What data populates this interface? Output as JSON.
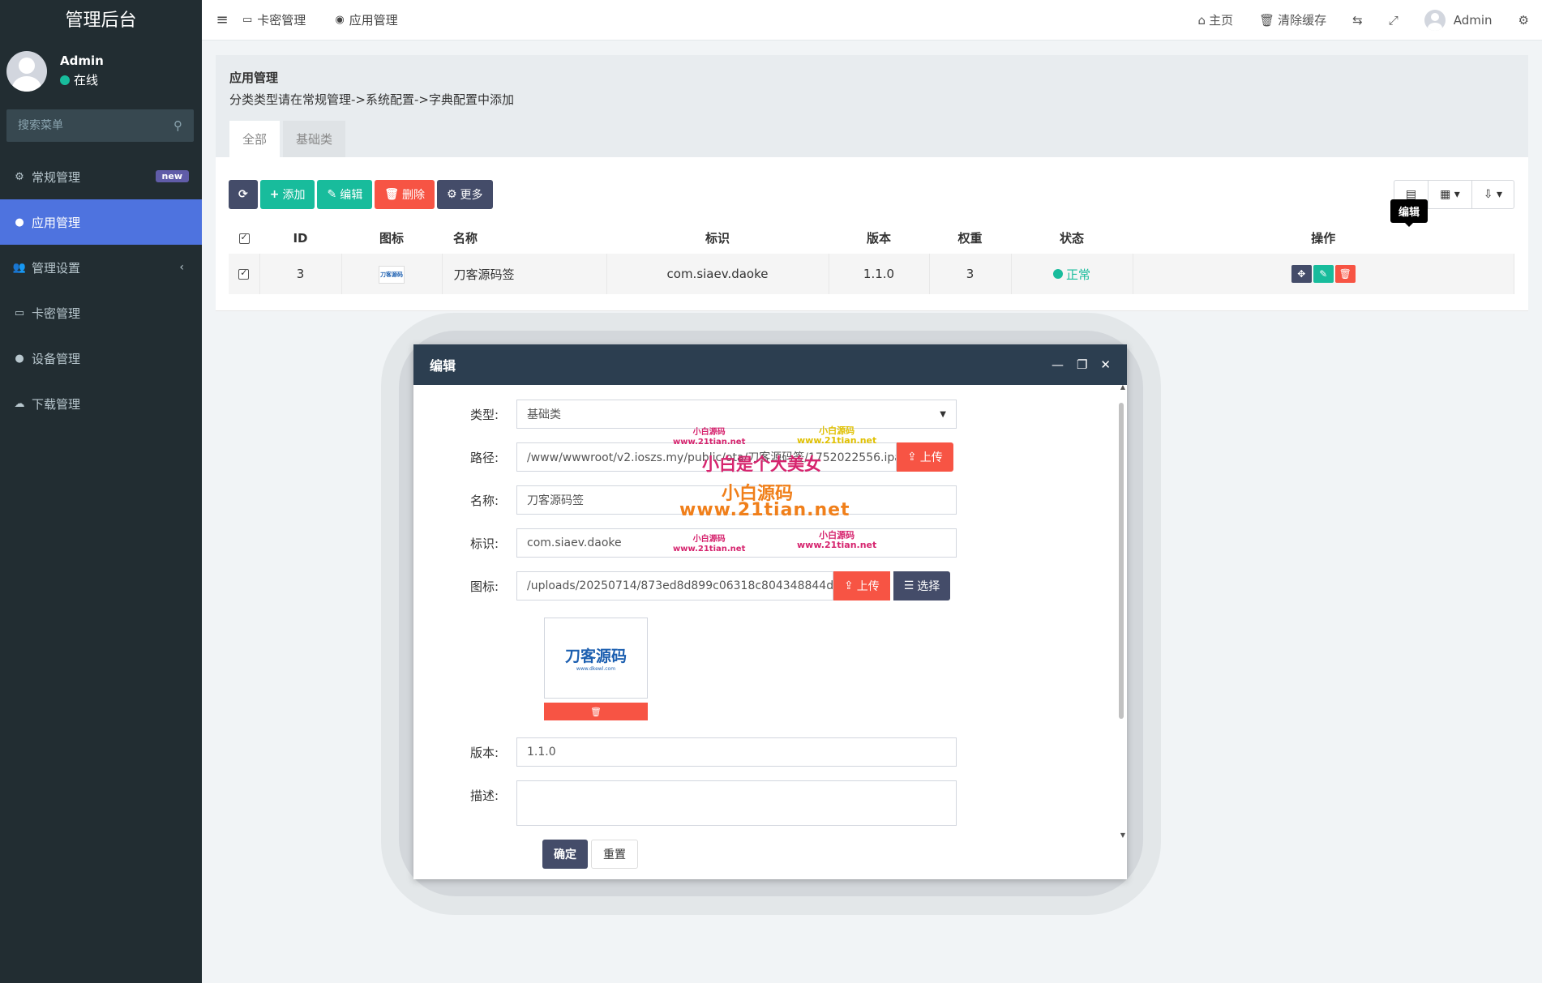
{
  "sidebar": {
    "logo": "管理后台",
    "user_name": "Admin",
    "user_status": "在线",
    "search_placeholder": "搜索菜单",
    "items": [
      {
        "label": "常规管理",
        "badge": "new"
      },
      {
        "label": "应用管理"
      },
      {
        "label": "管理设置"
      },
      {
        "label": "卡密管理"
      },
      {
        "label": "设备管理"
      },
      {
        "label": "下载管理"
      }
    ]
  },
  "topbar": {
    "tabs": [
      "卡密管理",
      "应用管理"
    ],
    "home": "主页",
    "clear_cache": "清除缓存",
    "user": "Admin"
  },
  "panel": {
    "title": "应用管理",
    "desc": "分类类型请在常规管理->系统配置->字典配置中添加",
    "tabs": [
      "全部",
      "基础类"
    ]
  },
  "toolbar": {
    "add": "添加",
    "edit": "编辑",
    "delete": "删除",
    "more": "更多"
  },
  "table": {
    "headers": [
      "ID",
      "图标",
      "名称",
      "标识",
      "版本",
      "权重",
      "状态",
      "操作"
    ],
    "rows": [
      {
        "id": "3",
        "icon_text": "刀客源码",
        "name": "刀客源码签",
        "ident": "com.siaev.daoke",
        "version": "1.1.0",
        "weight": "3",
        "status": "正常"
      }
    ],
    "tooltip": "编辑"
  },
  "modal": {
    "title": "编辑",
    "fields": {
      "type_label": "类型:",
      "type_value": "基础类",
      "path_label": "路径:",
      "path_value": "/www/wwwroot/v2.ioszs.my/public/ota/刀客源码签/1752022556.ipa",
      "upload": "上传",
      "name_label": "名称:",
      "name_value": "刀客源码签",
      "ident_label": "标识:",
      "ident_value": "com.siaev.daoke",
      "icon_label": "图标:",
      "icon_value": "/uploads/20250714/873ed8d899c06318c804348844df74(",
      "choose": "选择",
      "preview_title": "刀客源码",
      "preview_sub": "www.dkewl.com",
      "version_label": "版本:",
      "version_value": "1.1.0",
      "desc_label": "描述:",
      "desc_value": ""
    },
    "confirm": "确定",
    "reset": "重置"
  },
  "watermarks": {
    "small_cn": "小白源码",
    "small_url": "www.21tian.net",
    "big_line1": "小白是个大美女",
    "big_line2": "小白源码",
    "big_line3": "www.21tian.net"
  },
  "colors": {
    "sidebar_bg": "#222d32",
    "active_blue": "#4e73df",
    "primary_dark": "#444c69",
    "success": "#18bc9c",
    "danger": "#f75444",
    "modal_header": "#2c3e50"
  }
}
